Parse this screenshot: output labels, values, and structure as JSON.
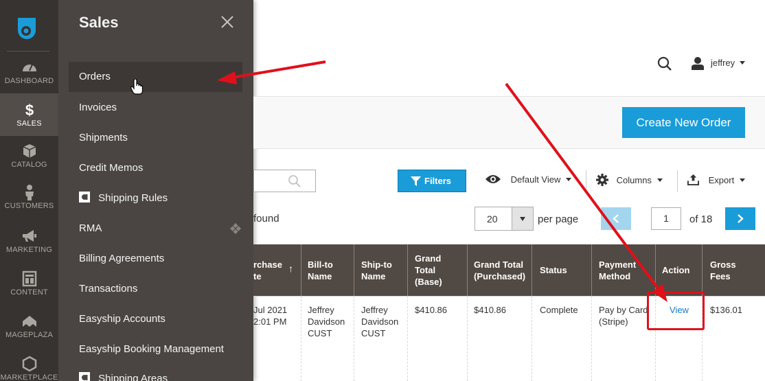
{
  "nav": {
    "items": [
      {
        "label": "DASHBOARD",
        "icon": "dashboard-icon"
      },
      {
        "label": "SALES",
        "icon": "dollar-icon"
      },
      {
        "label": "CATALOG",
        "icon": "box-icon"
      },
      {
        "label": "CUSTOMERS",
        "icon": "person-icon"
      },
      {
        "label": "MARKETING",
        "icon": "megaphone-icon"
      },
      {
        "label": "CONTENT",
        "icon": "layout-icon"
      },
      {
        "label": "MAGEPLAZA",
        "icon": "mageplaza-icon"
      },
      {
        "label": "MARKETPLACE",
        "icon": "hexagon-icon"
      }
    ],
    "active": "SALES"
  },
  "panel": {
    "title": "Sales",
    "items": [
      {
        "label": "Orders"
      },
      {
        "label": "Invoices"
      },
      {
        "label": "Shipments"
      },
      {
        "label": "Credit Memos"
      },
      {
        "label": "Shipping Rules"
      },
      {
        "label": "RMA"
      },
      {
        "label": "Billing Agreements"
      },
      {
        "label": "Transactions"
      },
      {
        "label": "Easyship Accounts"
      },
      {
        "label": "Easyship Booking Management"
      },
      {
        "label": "Shipping Areas"
      }
    ]
  },
  "header": {
    "username": "jeffrey"
  },
  "toolbar": {
    "create_label": "Create New Order",
    "filters_label": "Filters",
    "view_label": "Default View",
    "columns_label": "Columns",
    "export_label": "Export",
    "found_text": "found",
    "per_page_value": "20",
    "per_page_label": "per page",
    "page_value": "1",
    "page_of": "of 18"
  },
  "grid": {
    "headers": [
      {
        "label": "rchase te"
      },
      {
        "label": "Bill-to Name"
      },
      {
        "label": "Ship-to Name"
      },
      {
        "label": "Grand Total (Base)"
      },
      {
        "label": "Grand Total (Purchased)"
      },
      {
        "label": "Status"
      },
      {
        "label": "Payment Method"
      },
      {
        "label": "Action"
      },
      {
        "label": "Gross Fees"
      }
    ],
    "sort_arrow": "↑",
    "row": {
      "purchase_date": "Jul 2021 2:01 PM",
      "bill_to": "Jeffrey Davidson CUST",
      "ship_to": "Jeffrey Davidson CUST",
      "grand_total_base": "$410.86",
      "grand_total_purchased": "$410.86",
      "status": "Complete",
      "payment_method": "Pay by Card (Stripe)",
      "action": "View",
      "gross_fees": "$136.01"
    }
  },
  "colors": {
    "nav_bg": "#373330",
    "panel_bg": "#4a4542",
    "accent": "#1a9cd8",
    "grid_header": "#514943",
    "annotation": "#e0101a",
    "link": "#1979c3"
  }
}
